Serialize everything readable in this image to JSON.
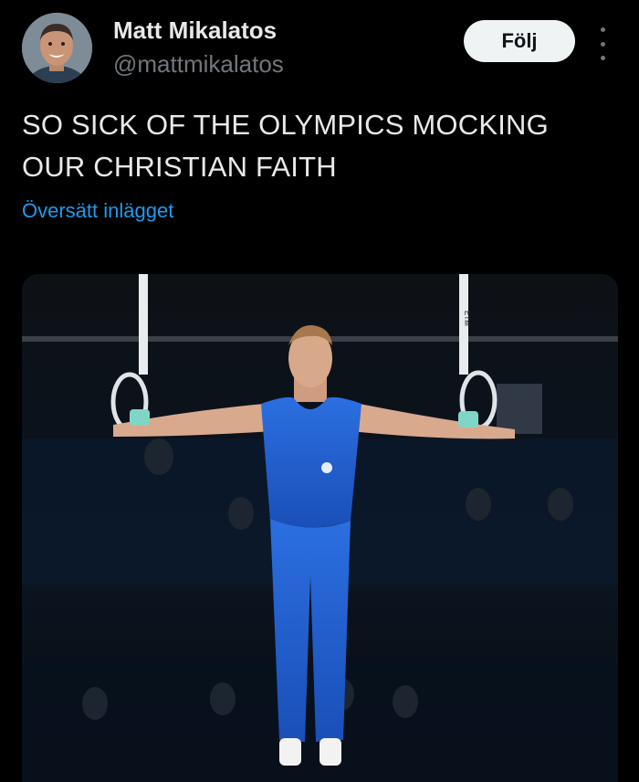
{
  "author": {
    "display_name": "Matt Mikalatos",
    "handle": "@mattmikalatos",
    "follow_label": "Följ"
  },
  "tweet": {
    "text": "SO SICK OF THE OLYMPICS MOCKING OUR CHRISTIAN FAITH",
    "translate_label": "Översätt inlägget"
  },
  "media": {
    "ring_strap_text": "ETM"
  },
  "colors": {
    "background": "#000000",
    "link": "#1d9bf0",
    "secondary_text": "#71767b",
    "follow_button_bg": "#eff3f4",
    "singlet": "#1f5fd0"
  },
  "icons": {
    "more": "more-vertical-icon"
  }
}
